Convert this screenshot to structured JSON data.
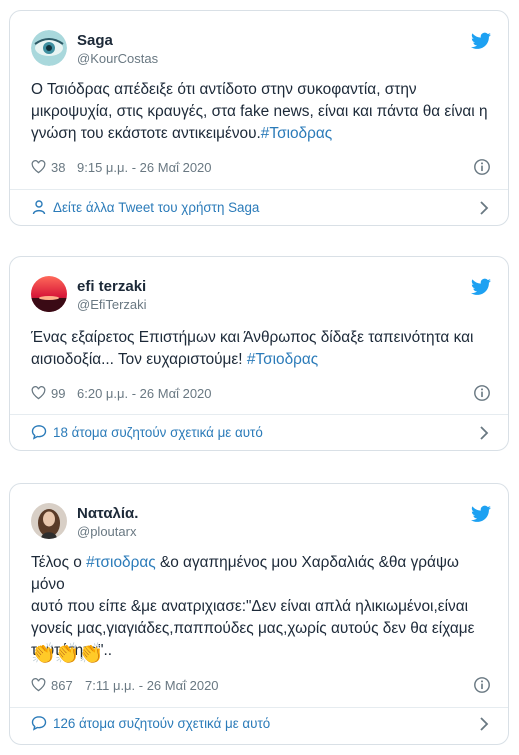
{
  "accent": "#2b7bb9",
  "tweets": [
    {
      "name": "Saga",
      "handle": "@KourCostas",
      "text_plain": "Ο Τσιόδρας  απέδειξε ότι αντίδοτο στην συκοφαντία, στην\nμικροψυχία, στις κραυγές, στα fake news, είναι και πάντα θα είναι η\nγνώση του εκάστοτε αντικειμένου.",
      "hashtag": "#Τσιοδρας",
      "likes": "38",
      "time": "9:15 μ.μ. - 26 Μαΐ 2020",
      "footer": "Δείτε άλλα Tweet του χρήστη Saga",
      "footer_icon": "person-icon"
    },
    {
      "name": "efi terzaki",
      "handle": "@EfiTerzaki",
      "text_plain": "Ένας εξαίρετος Επιστήμων και Άνθρωπος δίδαξε ταπεινότητα και\nαισιοδοξία... Τον ευχαριστούμε! ",
      "hashtag": "#Τσιοδρας",
      "likes": "99",
      "time": "6:20 μ.μ. - 26 Μαΐ 2020",
      "footer": "18 άτομα συζητούν σχετικά με αυτό",
      "footer_icon": "speech-bubble-icon"
    },
    {
      "name": "Ναταλία.",
      "handle": "@ploutarx",
      "text_before": "Τέλος ο ",
      "hashtag": "#τσιοδρας",
      "text_after": " &ο αγαπημένος μου Χαρδαλιάς &θα γράψω μόνο\nαυτό που είπε &με ανατριχιασε:\"Δεν είναι απλά ηλικιωμένοι,είναι\nγονείς μας,γιαγιάδες,παππούδες μας,χωρίς αυτούς δεν θα είχαμε\nταυτότητα\"..",
      "emoji": "👏👏👏",
      "likes": "867",
      "time": "7:11 μ.μ. - 26 Μαΐ 2020",
      "footer": "126 άτομα συζητούν σχετικά με αυτό",
      "footer_icon": "speech-bubble-icon"
    }
  ]
}
